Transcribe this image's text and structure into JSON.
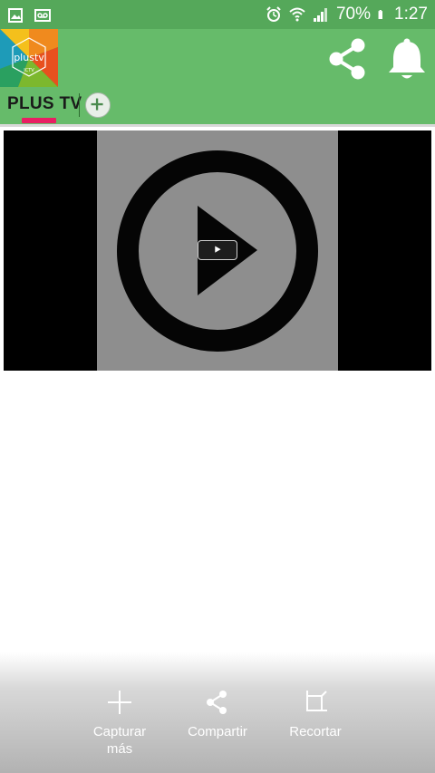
{
  "status_bar": {
    "battery_percent": "70%",
    "time": "1:27",
    "icons": [
      "gallery-icon",
      "voicemail-icon",
      "alarm-icon",
      "wifi-icon",
      "signal-icon",
      "battery-icon"
    ]
  },
  "app_bar": {
    "logo_text": "plustv",
    "logo_subtext": "ICTV",
    "actions": [
      "share-icon",
      "bell-icon"
    ]
  },
  "tabs": [
    {
      "label": "PLUS TV",
      "active": true
    }
  ],
  "colors": {
    "status_bar": "#55a85a",
    "app_bar": "#66bb6a",
    "tab_indicator": "#e91e63",
    "video_bg": "#000000",
    "thumbnail": "#8e8e8e"
  },
  "video": {
    "thumbnail_icon": "play-circle-icon",
    "overlay_icon": "play-button-icon"
  },
  "bottom_bar": {
    "actions": [
      {
        "label": "Capturar más",
        "icon": "plus-icon"
      },
      {
        "label": "Compartir",
        "icon": "share-icon"
      },
      {
        "label": "Recortar",
        "icon": "crop-icon"
      }
    ]
  }
}
